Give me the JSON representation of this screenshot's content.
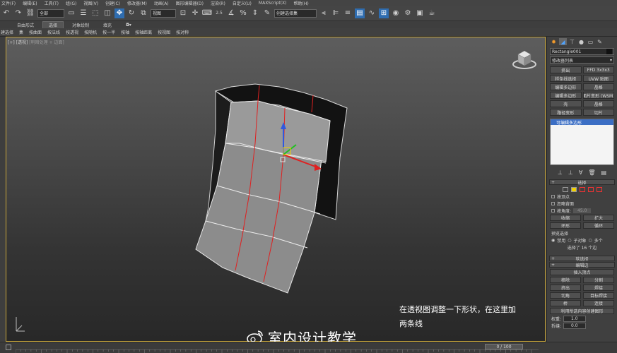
{
  "menubar": {
    "items": [
      "文件(F)",
      "编辑(E)",
      "工具(T)",
      "组(G)",
      "视图(V)",
      "创建(C)",
      "修改器(M)",
      "动画(A)",
      "图形编辑器(D)",
      "渲染(R)",
      "自定义(U)",
      "MAXScript(X)",
      "帮助(H)"
    ]
  },
  "toolbar": {
    "selection_filter": "全部",
    "ref_coord": "视图",
    "named_selection": "创建选择集",
    "snap_label": "2.5"
  },
  "ribbon": {
    "tabs": [
      "自由形式",
      "选择",
      "对象绘制",
      "填充"
    ],
    "selected_tab": "选择",
    "commands": [
      "建选择",
      "集",
      "按曲面",
      "按法线",
      "按透视",
      "按随机",
      "按一半",
      "按轴",
      "按轴距离",
      "按视图",
      "按对称"
    ]
  },
  "viewport": {
    "label_main": "[+] [透视]",
    "label_sub": "[明暗处理 + 边面]",
    "caption_line1": "在透视图调整一下形状，在这里加",
    "caption_line2": "两条线",
    "watermark": "室内设计教学",
    "accent_color": "#c8a63a"
  },
  "command_panel": {
    "object_name": "Rectangle001",
    "modifier_list": "修改器列表",
    "modifier_buttons": [
      "挤出",
      "FFD 3x3x3",
      "样条线选择",
      "UVW 贴图",
      "编辑多边形",
      "晶格",
      "编辑多边形",
      "面片变形 (WSM)",
      "壳",
      "晶格",
      "路径变形",
      "切片"
    ],
    "stack_item": "可编辑多边形",
    "selection_header": "选择",
    "by_vertex": "按顶点",
    "ignore_backfacing": "忽略背面",
    "by_angle": "按角度:",
    "angle_value": "45.0",
    "shrink": "收缩",
    "grow": "扩大",
    "ring": "环形",
    "loop": "循环",
    "preview_selection": "预览选择",
    "preview_off": "禁用",
    "preview_subobj": "子对象",
    "preview_multi": "多个",
    "selected_count": "选择了 16 个边",
    "soft_selection": "软选择",
    "edit_edges": "编辑边",
    "insert_vertex": "插入顶点",
    "remove": "移除",
    "split": "分割",
    "extrude": "挤出",
    "weld": "焊接",
    "chamfer": "切角",
    "target_weld": "目标焊接",
    "bridge": "桥",
    "connect": "连接",
    "create_shape": "利用所选内容创建图形",
    "weight_label": "权重:",
    "weight_value": "1.0",
    "crease_label": "折缝:",
    "crease_value": "0.0"
  },
  "timeline": {
    "frame_display": "0 / 100"
  }
}
